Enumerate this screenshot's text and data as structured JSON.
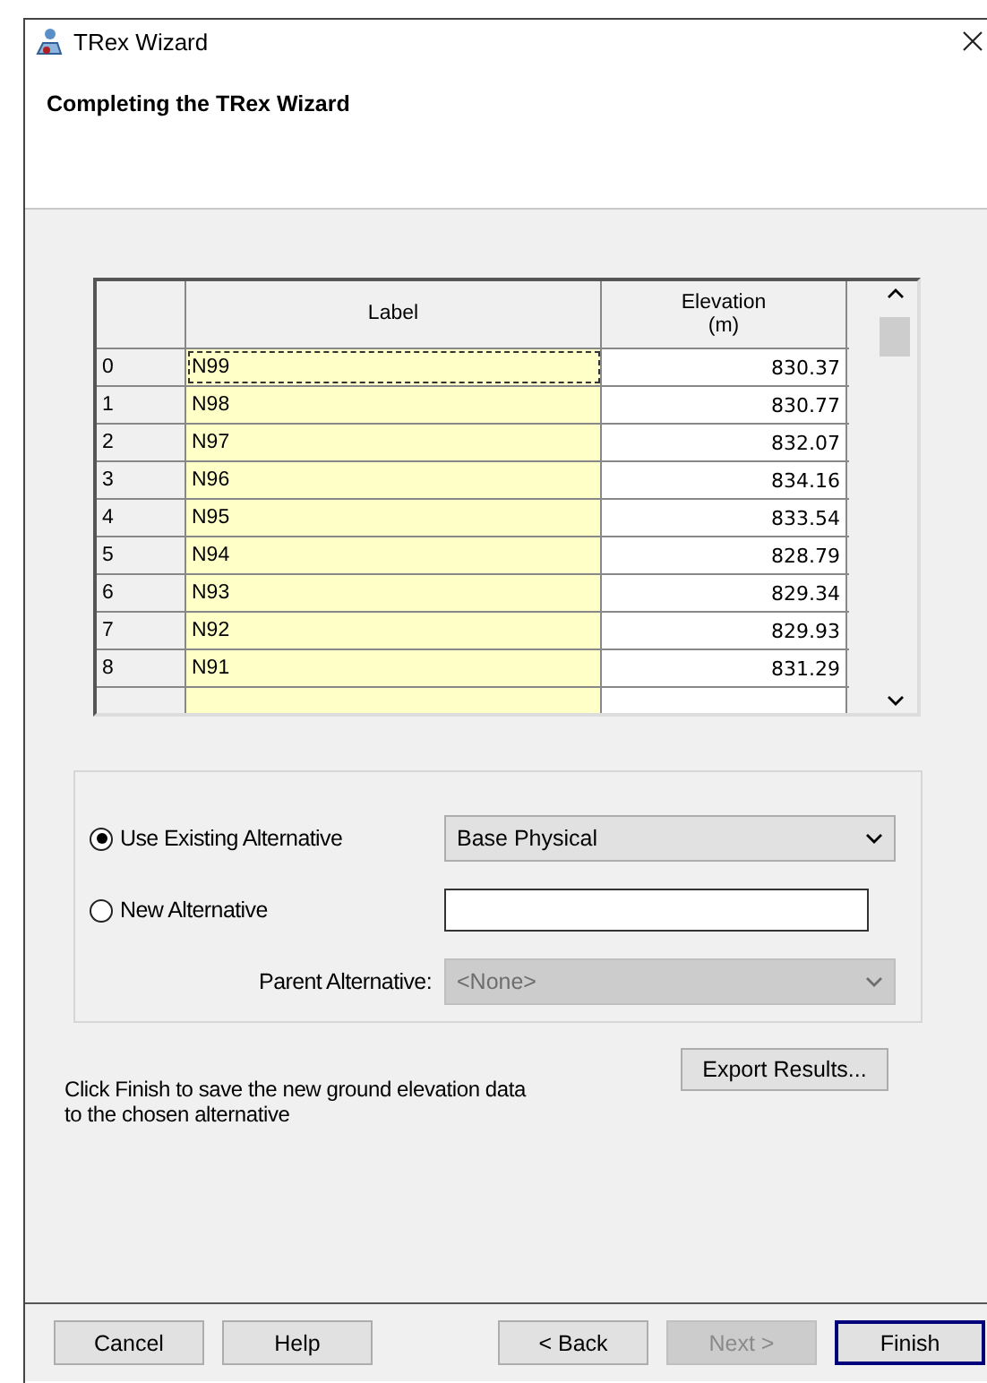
{
  "window": {
    "title": "TRex Wizard"
  },
  "header": {
    "title": "Completing the TRex Wizard"
  },
  "table": {
    "columns": [
      {
        "label": "Label"
      },
      {
        "label": "Elevation (m)"
      }
    ],
    "rows": [
      {
        "index": "0",
        "label": "N99",
        "elevation": "830.37",
        "focused": true
      },
      {
        "index": "1",
        "label": "N98",
        "elevation": "830.77",
        "focused": false
      },
      {
        "index": "2",
        "label": "N97",
        "elevation": "832.07",
        "focused": false
      },
      {
        "index": "3",
        "label": "N96",
        "elevation": "834.16",
        "focused": false
      },
      {
        "index": "4",
        "label": "N95",
        "elevation": "833.54",
        "focused": false
      },
      {
        "index": "5",
        "label": "N94",
        "elevation": "828.79",
        "focused": false
      },
      {
        "index": "6",
        "label": "N93",
        "elevation": "829.34",
        "focused": false
      },
      {
        "index": "7",
        "label": "N92",
        "elevation": "829.93",
        "focused": false
      },
      {
        "index": "8",
        "label": "N91",
        "elevation": "831.29",
        "focused": false
      }
    ]
  },
  "alternative": {
    "options": [
      {
        "label": "Use Existing Alternative",
        "selected": true,
        "kind": "dropdown",
        "value": "Base Physical"
      },
      {
        "label": "New Alternative",
        "selected": false,
        "kind": "text"
      }
    ],
    "parent": {
      "label": "Parent Alternative:",
      "value": "<None>",
      "disabled": true
    }
  },
  "message": "Click Finish to save the new ground elevation data to the chosen alternative",
  "export_button": "Export Results...",
  "buttons": [
    {
      "label": "Cancel",
      "disabled": false,
      "default": false
    },
    {
      "label": "Help",
      "disabled": false,
      "default": false
    },
    {
      "label": "< Back",
      "disabled": false,
      "default": false
    },
    {
      "label": "Next >",
      "disabled": true,
      "default": false
    },
    {
      "label": "Finish",
      "disabled": false,
      "default": true
    }
  ]
}
